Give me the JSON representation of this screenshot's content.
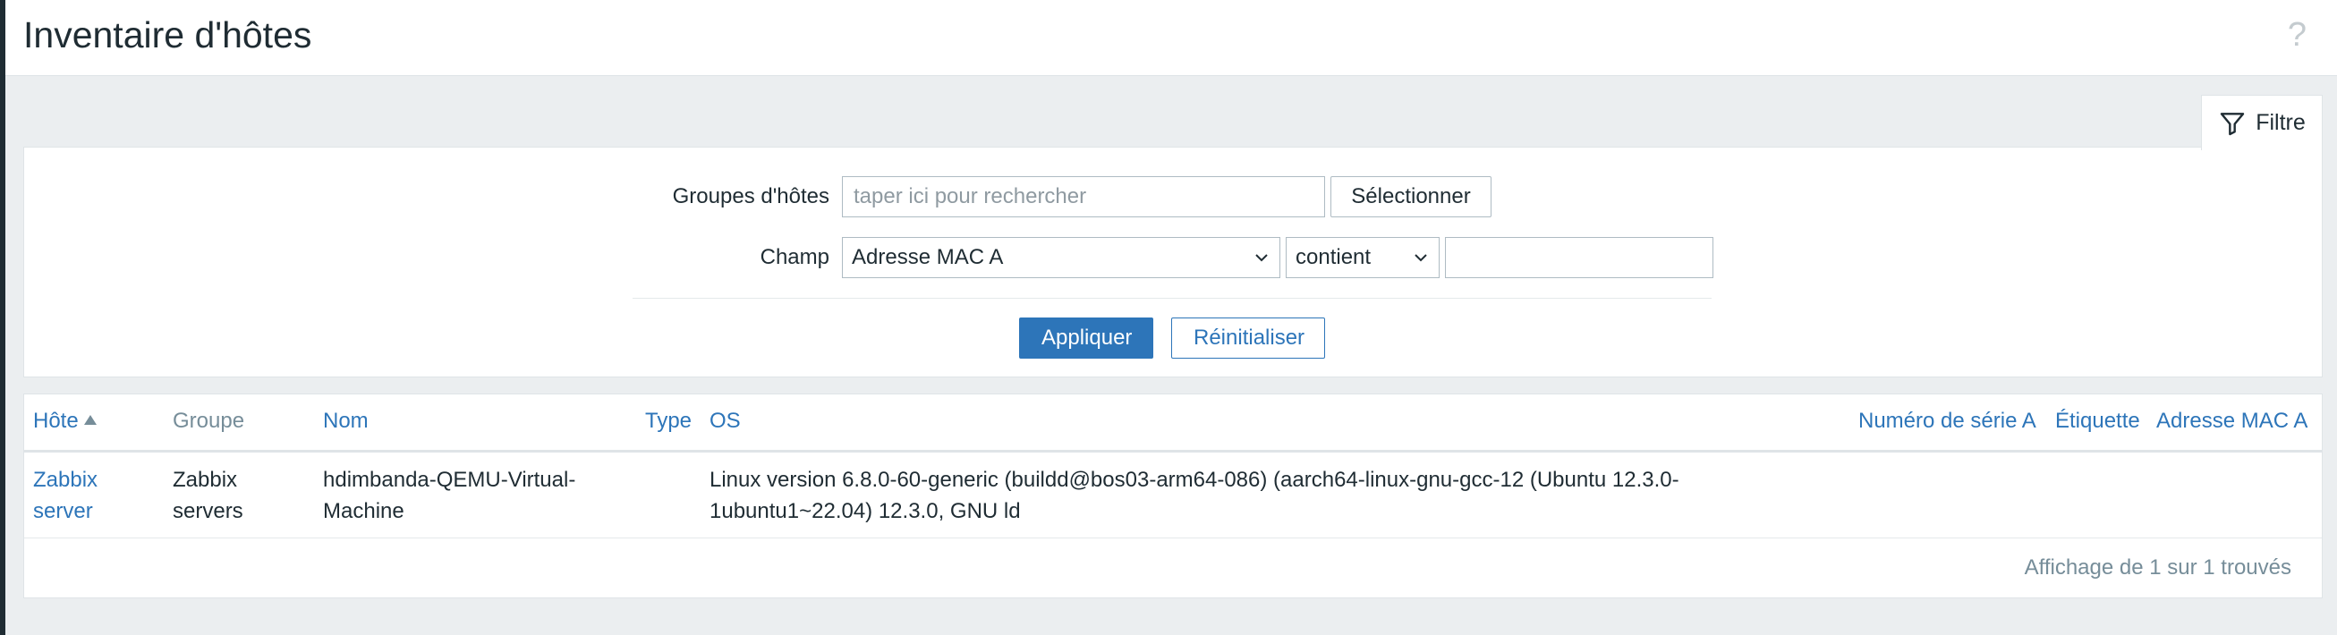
{
  "page": {
    "title": "Inventaire d'hôtes",
    "help": "?"
  },
  "filter": {
    "tab_label": "Filtre",
    "host_groups": {
      "label": "Groupes d'hôtes",
      "placeholder": "taper ici pour rechercher",
      "select_button": "Sélectionner"
    },
    "field": {
      "label": "Champ",
      "selected": "Adresse MAC A",
      "operator": "contient",
      "value": ""
    },
    "apply": "Appliquer",
    "reset": "Réinitialiser"
  },
  "table": {
    "headers": {
      "host": "Hôte",
      "group": "Groupe",
      "name": "Nom",
      "type": "Type",
      "os": "OS",
      "serial": "Numéro de série A",
      "tag": "Étiquette",
      "mac": "Adresse MAC A"
    },
    "rows": [
      {
        "host_line1": "Zabbix",
        "host_line2": "server",
        "group_line1": "Zabbix",
        "group_line2": "servers",
        "name_line1": "hdimbanda-QEMU-Virtual-",
        "name_line2": "Machine",
        "os_line1": "Linux version 6.8.0-60-generic (buildd@bos03-arm64-086) (aarch64-linux-gnu-gcc-12 (Ubuntu 12.3.0-",
        "os_line2": "1ubuntu1~22.04) 12.3.0, GNU ld"
      }
    ],
    "footer": "Affichage de 1 sur 1 trouvés"
  },
  "colors": {
    "accent": "#2d75b9",
    "background": "#ebeef0",
    "panel": "#ffffff"
  },
  "icons": {
    "filter": "funnel-icon",
    "help": "question-mark-icon",
    "sort": "sort-ascending-icon",
    "dropdown": "chevron-down-icon"
  }
}
